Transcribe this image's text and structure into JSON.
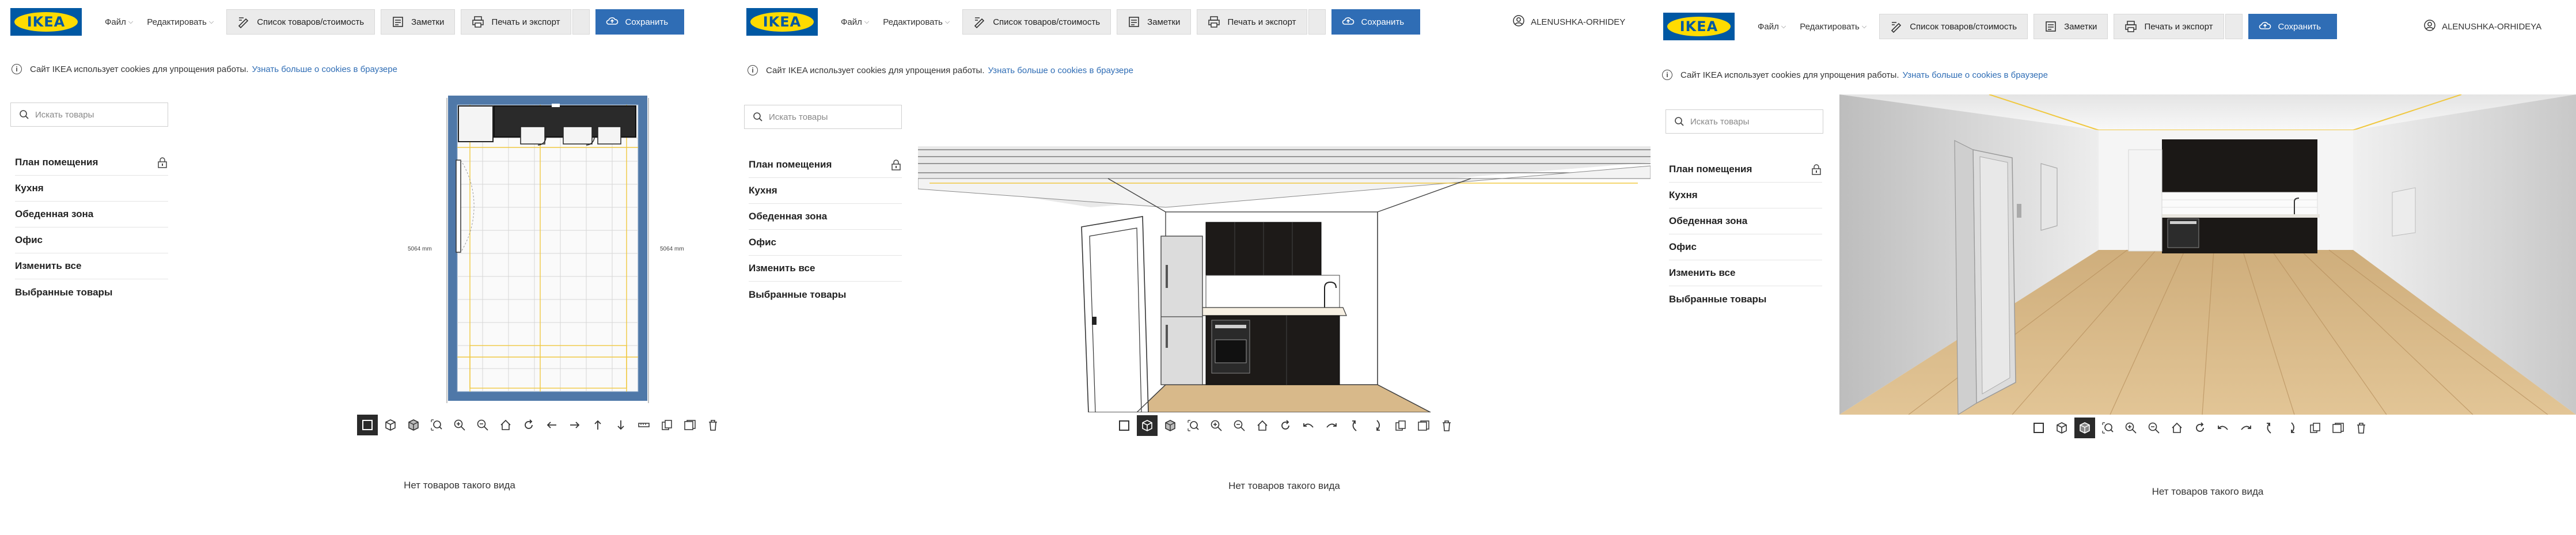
{
  "header": {
    "logo_text": "IKEA",
    "menu_file": "Файл",
    "menu_edit": "Редактировать",
    "list_button": "Список товаров/стоимость",
    "notes_button": "Заметки",
    "print_button": "Печать и экспорт",
    "save_button": "Сохранить",
    "username": "ALENUSHKA-ORHIDEY",
    "username_short": "ALENUSHKA-ORHIDEYA"
  },
  "cookie": {
    "text": "Сайт IKEA использует cookies для упрощения работы.",
    "link": "Узнать больше о cookies в браузере"
  },
  "sidebar": {
    "search_placeholder": "Искать товары",
    "items": [
      {
        "label": "План помещения"
      },
      {
        "label": "Кухня"
      },
      {
        "label": "Обеденная зона"
      },
      {
        "label": "Офис"
      },
      {
        "label": "Изменить все"
      },
      {
        "label": "Выбранные товары"
      }
    ]
  },
  "floorplan": {
    "dim_left": "5064 mm",
    "dim_right": "5064 mm"
  },
  "bottom": {
    "empty_text": "Нет товаров такого вида"
  },
  "colors": {
    "accent": "#2f6db5",
    "wall_blue": "#4f78a8",
    "cabinet": "#1d1a18",
    "floor": "#d8b98a"
  }
}
